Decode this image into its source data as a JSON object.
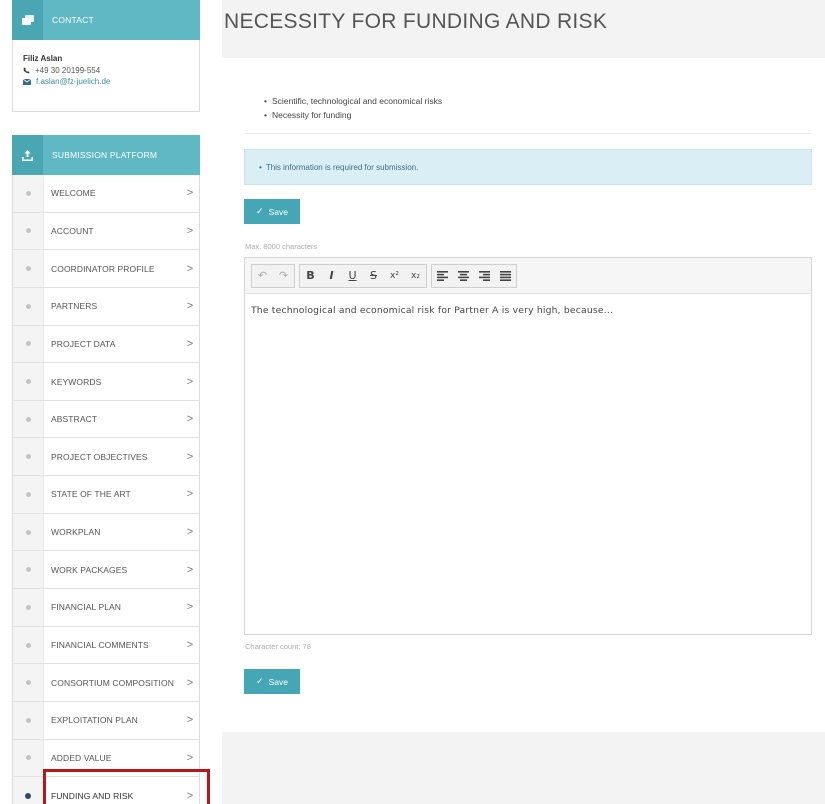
{
  "contact": {
    "heading": "CONTACT",
    "name": "Filiz Aslan",
    "phone": "+49 30 20199-554",
    "email": "f.aslan@fz-juelich.de"
  },
  "submission": {
    "heading": "SUBMISSION PLATFORM",
    "items": [
      {
        "label": "WELCOME"
      },
      {
        "label": "ACCOUNT"
      },
      {
        "label": "COORDINATOR PROFILE"
      },
      {
        "label": "PARTNERS"
      },
      {
        "label": "PROJECT DATA"
      },
      {
        "label": "KEYWORDS"
      },
      {
        "label": "ABSTRACT"
      },
      {
        "label": "PROJECT OBJECTIVES"
      },
      {
        "label": "STATE OF THE ART"
      },
      {
        "label": "WORKPLAN"
      },
      {
        "label": "WORK PACKAGES"
      },
      {
        "label": "FINANCIAL PLAN"
      },
      {
        "label": "FINANCIAL COMMENTS"
      },
      {
        "label": "CONSORTIUM COMPOSITION"
      },
      {
        "label": "EXPLOITATION PLAN"
      },
      {
        "label": "ADDED VALUE"
      },
      {
        "label": "FUNDING AND RISK"
      }
    ],
    "chevron": ">"
  },
  "page": {
    "title": "NECESSITY FOR FUNDING AND RISK",
    "bullets": [
      "Scientific, technological and economical risks",
      "Necessity for funding"
    ],
    "info": "This information is required for submission.",
    "save_label": "Save",
    "max_chars": "Max. 8000 characters",
    "editor_text": "The technological and economical risk for Partner A is very high, because...",
    "char_count": "Character count: 78"
  },
  "toolbar": {
    "undo": "↶",
    "redo": "↷",
    "bold": "B",
    "italic": "I",
    "underline": "U",
    "strike": "S",
    "superscript": "x²",
    "subscript": "x₂"
  },
  "colors": {
    "accent": "#5fb8c4",
    "button": "#45a7b5",
    "info_bg": "#d9eef5",
    "highlight": "#b61818",
    "active_dot": "#2c4a6a"
  }
}
